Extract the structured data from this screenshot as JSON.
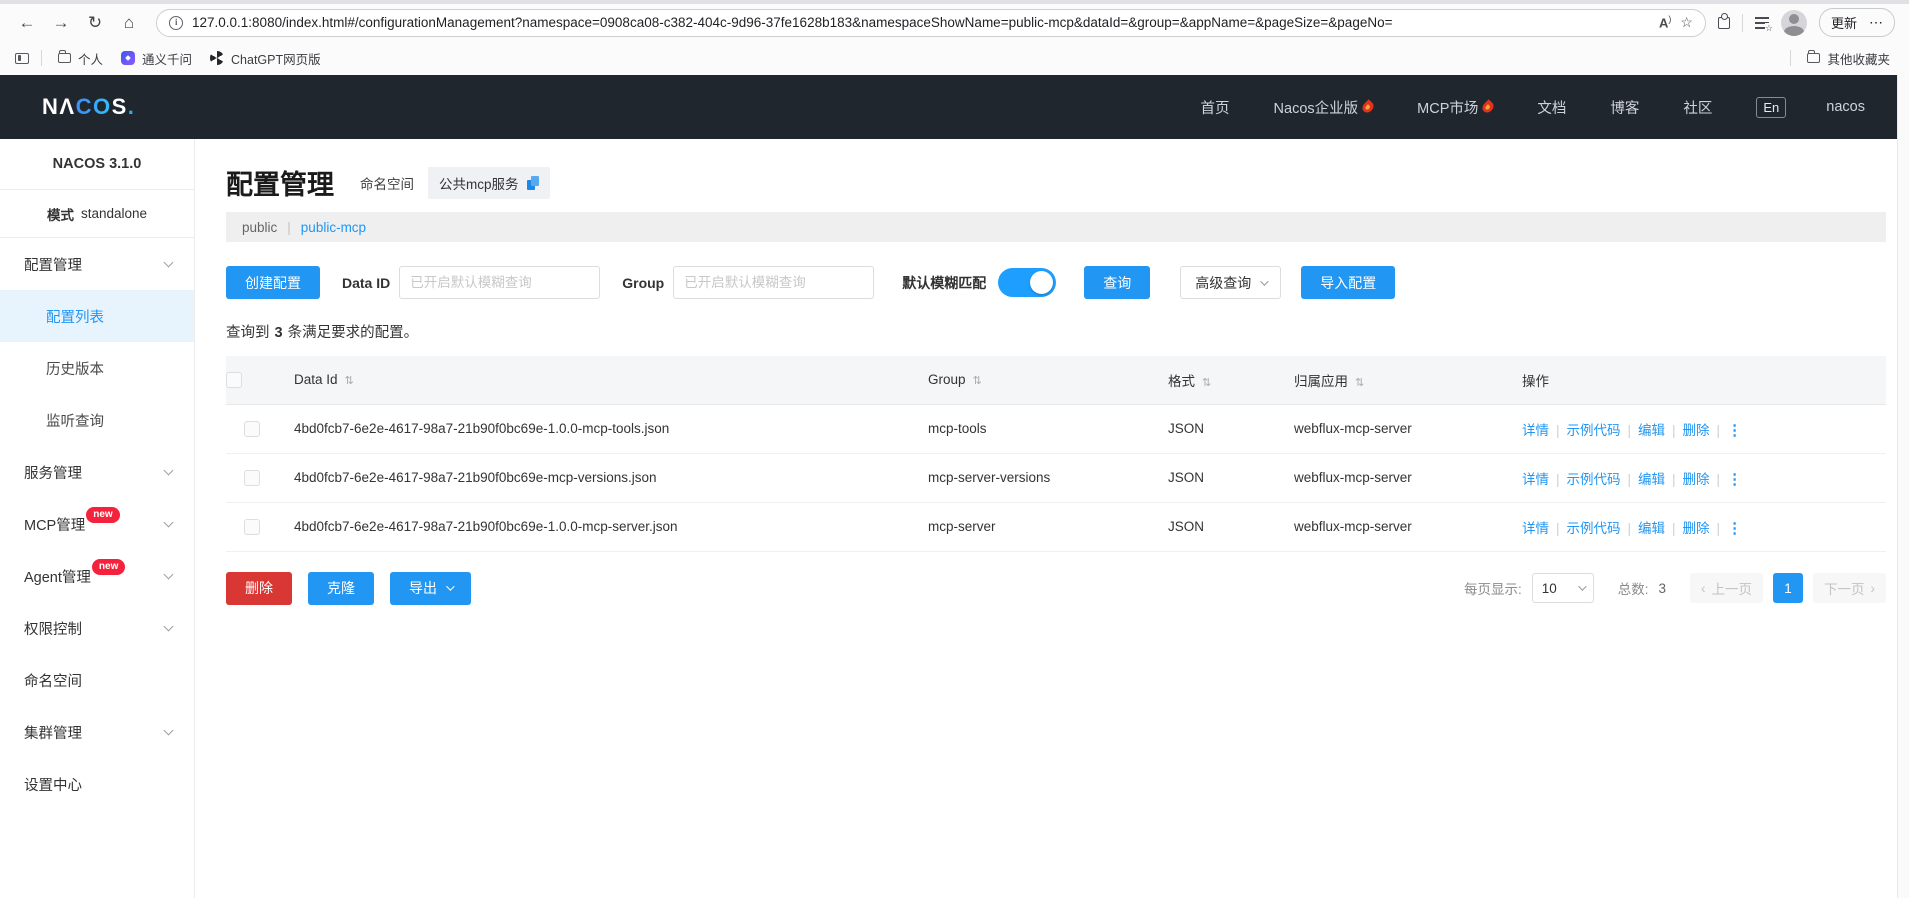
{
  "colors": {
    "primary": "#2196f3",
    "danger": "#d93734",
    "badge": "#f5223d",
    "header_bg": "#20262e",
    "active_bg": "#e7f3fd"
  },
  "icons": {
    "back": "←",
    "forward": "→",
    "reload": "↻",
    "home": "⌂",
    "star": "☆",
    "more_h": "⋯",
    "read_aloud": "A",
    "sort": "⇅",
    "more_v": "⋮",
    "prev": "‹",
    "next": "›"
  },
  "browser": {
    "url": "127.0.0.1:8080/index.html#/configurationManagement?namespace=0908ca08-c382-404c-9d96-37fe1628b183&namespaceShowName=public-mcp&dataId=&group=&appName=&pageSize=&pageNo=",
    "update_label": "更新",
    "bookmarks": [
      {
        "label": "个人",
        "icon": "folder-icon"
      },
      {
        "label": "通义千问",
        "icon": "qwen-icon"
      },
      {
        "label": "ChatGPT网页版",
        "icon": "chatgpt-icon"
      }
    ],
    "other_favorites": "其他收藏夹"
  },
  "header": {
    "brand_parts": {
      "left": "NΛ",
      "mid": "CO",
      "right": "S",
      "dot": "."
    },
    "nav": [
      {
        "label": "首页",
        "hot": false
      },
      {
        "label": "Nacos企业版",
        "hot": true
      },
      {
        "label": "MCP市场",
        "hot": true
      },
      {
        "label": "文档",
        "hot": false
      },
      {
        "label": "博客",
        "hot": false
      },
      {
        "label": "社区",
        "hot": false
      }
    ],
    "lang": "En",
    "user": "nacos"
  },
  "sidebar": {
    "version": "NACOS 3.1.0",
    "mode_label": "模式",
    "mode_value": "standalone",
    "menu": [
      {
        "label": "配置管理",
        "type": "group",
        "chevron": true
      },
      {
        "label": "配置列表",
        "type": "sub",
        "active": true
      },
      {
        "label": "历史版本",
        "type": "sub"
      },
      {
        "label": "监听查询",
        "type": "sub"
      },
      {
        "label": "服务管理",
        "type": "group",
        "chevron": true
      },
      {
        "label": "MCP管理",
        "type": "group",
        "chevron": true,
        "badge": "new"
      },
      {
        "label": "Agent管理",
        "type": "group",
        "chevron": true,
        "badge": "new"
      },
      {
        "label": "权限控制",
        "type": "group",
        "chevron": true
      },
      {
        "label": "命名空间",
        "type": "group"
      },
      {
        "label": "集群管理",
        "type": "group",
        "chevron": true
      },
      {
        "label": "设置中心",
        "type": "group"
      }
    ]
  },
  "main": {
    "title": "配置管理",
    "namespace_label": "命名空间",
    "namespace_tag": "公共mcp服务",
    "ns_tabs": [
      {
        "label": "public",
        "active": false
      },
      {
        "label": "public-mcp",
        "active": true
      }
    ],
    "toolbar": {
      "create": "创建配置",
      "dataid_label": "Data ID",
      "dataid_placeholder": "已开启默认模糊查询",
      "dataid_value": "",
      "group_label": "Group",
      "group_placeholder": "已开启默认模糊查询",
      "group_value": "",
      "fuzzy_label": "默认模糊匹配",
      "fuzzy_on": true,
      "search": "查询",
      "advanced": "高级查询",
      "import": "导入配置"
    },
    "result": {
      "prefix": "查询到",
      "count": "3",
      "suffix": "条满足要求的配置。"
    },
    "table": {
      "headers": [
        {
          "label": "Data Id",
          "sortable": true
        },
        {
          "label": "Group",
          "sortable": true
        },
        {
          "label": "格式",
          "sortable": true
        },
        {
          "label": "归属应用",
          "sortable": true
        },
        {
          "label": "操作",
          "sortable": false
        }
      ],
      "rows": [
        {
          "data_id": "4bd0fcb7-6e2e-4617-98a7-21b90f0bc69e-1.0.0-mcp-tools.json",
          "group": "mcp-tools",
          "format": "JSON",
          "app": "webflux-mcp-server"
        },
        {
          "data_id": "4bd0fcb7-6e2e-4617-98a7-21b90f0bc69e-mcp-versions.json",
          "group": "mcp-server-versions",
          "format": "JSON",
          "app": "webflux-mcp-server"
        },
        {
          "data_id": "4bd0fcb7-6e2e-4617-98a7-21b90f0bc69e-1.0.0-mcp-server.json",
          "group": "mcp-server",
          "format": "JSON",
          "app": "webflux-mcp-server"
        }
      ],
      "row_actions": [
        "详情",
        "示例代码",
        "编辑",
        "删除"
      ]
    },
    "footer": {
      "delete": "删除",
      "clone": "克隆",
      "export": "导出",
      "page_size_label": "每页显示:",
      "page_size": "10",
      "total_label": "总数:",
      "total": "3",
      "prev": "上一页",
      "page": "1",
      "next": "下一页"
    }
  }
}
